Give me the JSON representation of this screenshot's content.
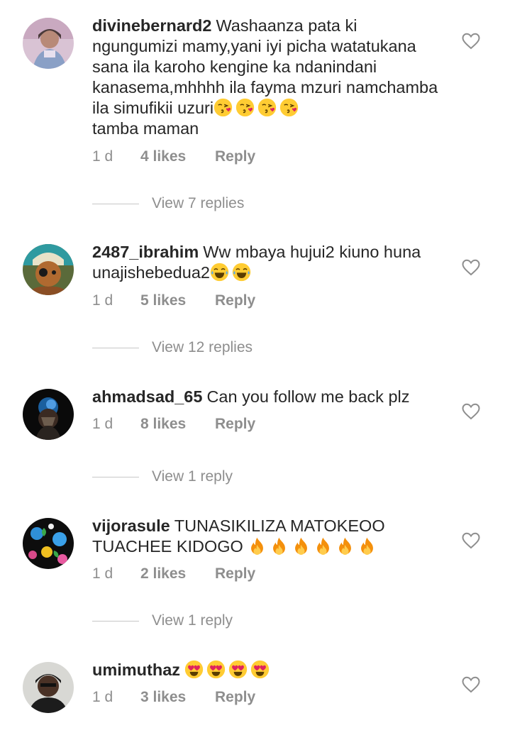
{
  "comments": [
    {
      "username": "divinebernard2",
      "text": "Washaanza pata ki ngungumizi mamy,yani iyi picha watatukana sana ila karoho kengine ka ndanindani kanasema,mhhhh ila fayma mzuri namchamba ila simufikii uzuri",
      "text_tail": "tamba maman",
      "emojis": [
        "kissing-heart-emoji",
        "kissing-heart-emoji",
        "kissing-heart-emoji",
        "kissing-heart-emoji"
      ],
      "time": "1 d",
      "likes": "4 likes",
      "reply": "Reply",
      "view_replies": "View 7 replies"
    },
    {
      "username": "2487_ibrahim",
      "text": "Ww mbaya hujui2 kiuno huna unajishebedua2",
      "emojis": [
        "tears-of-joy-emoji",
        "tears-of-joy-emoji"
      ],
      "time": "1 d",
      "likes": "5 likes",
      "reply": "Reply",
      "view_replies": "View 12 replies"
    },
    {
      "username": "ahmadsad_65",
      "text": "Can you follow me back plz",
      "time": "1 d",
      "likes": "8 likes",
      "reply": "Reply",
      "view_replies": "View 1 reply"
    },
    {
      "username": "vijorasule",
      "text": "TUNASIKILIZA MATOKEOO TUACHEE KIDOGO",
      "emojis": [
        "fire-emoji",
        "fire-emoji",
        "fire-emoji",
        "fire-emoji",
        "fire-emoji",
        "fire-emoji"
      ],
      "time": "1 d",
      "likes": "2 likes",
      "reply": "Reply",
      "view_replies": "View 1 reply"
    },
    {
      "username": "umimuthaz",
      "text": "",
      "emojis": [
        "heart-eyes-emoji",
        "heart-eyes-emoji",
        "heart-eyes-emoji",
        "heart-eyes-emoji"
      ],
      "time": "1 d",
      "likes": "3 likes",
      "reply": "Reply"
    }
  ],
  "icons": {
    "like": "heart-outline-icon"
  },
  "colors": {
    "text": "#262626",
    "secondary": "#8e8e8e",
    "divider": "#c7c7c7"
  }
}
